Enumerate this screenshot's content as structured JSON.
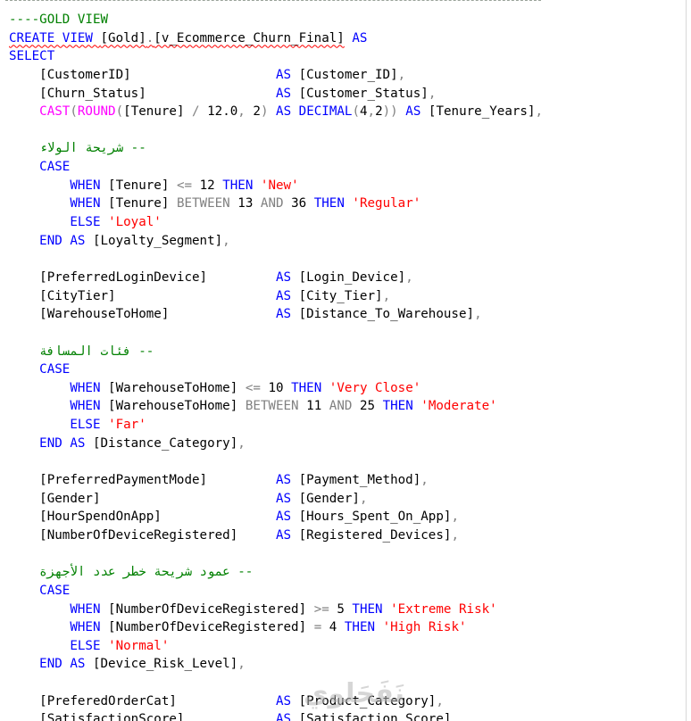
{
  "editor": {
    "lines": [
      [
        {
          "c": "cm",
          "t": "----GOLD VIEW"
        }
      ],
      [
        {
          "c": "kw",
          "t": "CREATE VIEW ",
          "sq": true
        },
        {
          "c": "tx",
          "t": "[Gold]",
          "sq": true
        },
        {
          "c": "op",
          "t": ".",
          "sq": true
        },
        {
          "c": "tx",
          "t": "[v_Ecommerce_Churn_Final]",
          "sq": true
        },
        {
          "c": "tx",
          "t": " "
        },
        {
          "c": "kw",
          "t": "AS"
        }
      ],
      [
        {
          "c": "kw",
          "t": "SELECT"
        }
      ],
      [
        {
          "c": "tx",
          "t": "    [CustomerID]                   "
        },
        {
          "c": "kw",
          "t": "AS"
        },
        {
          "c": "tx",
          "t": " [Customer_ID]"
        },
        {
          "c": "op",
          "t": ","
        }
      ],
      [
        {
          "c": "tx",
          "t": "    [Churn_Status]                 "
        },
        {
          "c": "kw",
          "t": "AS"
        },
        {
          "c": "tx",
          "t": " [Customer_Status]"
        },
        {
          "c": "op",
          "t": ","
        }
      ],
      [
        {
          "c": "tx",
          "t": "    "
        },
        {
          "c": "fn",
          "t": "CAST"
        },
        {
          "c": "op",
          "t": "("
        },
        {
          "c": "fn",
          "t": "ROUND"
        },
        {
          "c": "op",
          "t": "("
        },
        {
          "c": "tx",
          "t": "[Tenure] "
        },
        {
          "c": "op",
          "t": "/"
        },
        {
          "c": "tx",
          "t": " 12.0"
        },
        {
          "c": "op",
          "t": ","
        },
        {
          "c": "tx",
          "t": " 2"
        },
        {
          "c": "op",
          "t": ")"
        },
        {
          "c": "tx",
          "t": " "
        },
        {
          "c": "kw",
          "t": "AS DECIMAL"
        },
        {
          "c": "op",
          "t": "("
        },
        {
          "c": "tx",
          "t": "4"
        },
        {
          "c": "op",
          "t": ","
        },
        {
          "c": "tx",
          "t": "2"
        },
        {
          "c": "op",
          "t": "))"
        },
        {
          "c": "tx",
          "t": " "
        },
        {
          "c": "kw",
          "t": "AS"
        },
        {
          "c": "tx",
          "t": " [Tenure_Years]"
        },
        {
          "c": "op",
          "t": ","
        }
      ],
      [
        {
          "c": "tx",
          "t": ""
        }
      ],
      [
        {
          "c": "tx",
          "t": "    "
        },
        {
          "c": "cm",
          "t": "-- شريحة الولاء"
        }
      ],
      [
        {
          "c": "tx",
          "t": "    "
        },
        {
          "c": "kw",
          "t": "CASE"
        }
      ],
      [
        {
          "c": "tx",
          "t": "        "
        },
        {
          "c": "kw",
          "t": "WHEN"
        },
        {
          "c": "tx",
          "t": " [Tenure] "
        },
        {
          "c": "op",
          "t": "<="
        },
        {
          "c": "tx",
          "t": " 12 "
        },
        {
          "c": "kw",
          "t": "THEN"
        },
        {
          "c": "tx",
          "t": " "
        },
        {
          "c": "str",
          "t": "'New'"
        }
      ],
      [
        {
          "c": "tx",
          "t": "        "
        },
        {
          "c": "kw",
          "t": "WHEN"
        },
        {
          "c": "tx",
          "t": " [Tenure] "
        },
        {
          "c": "op",
          "t": "BETWEEN"
        },
        {
          "c": "tx",
          "t": " 13 "
        },
        {
          "c": "op",
          "t": "AND"
        },
        {
          "c": "tx",
          "t": " 36 "
        },
        {
          "c": "kw",
          "t": "THEN"
        },
        {
          "c": "tx",
          "t": " "
        },
        {
          "c": "str",
          "t": "'Regular'"
        }
      ],
      [
        {
          "c": "tx",
          "t": "        "
        },
        {
          "c": "kw",
          "t": "ELSE"
        },
        {
          "c": "tx",
          "t": " "
        },
        {
          "c": "str",
          "t": "'Loyal'"
        }
      ],
      [
        {
          "c": "tx",
          "t": "    "
        },
        {
          "c": "kw",
          "t": "END AS"
        },
        {
          "c": "tx",
          "t": " [Loyalty_Segment]"
        },
        {
          "c": "op",
          "t": ","
        }
      ],
      [
        {
          "c": "tx",
          "t": ""
        }
      ],
      [
        {
          "c": "tx",
          "t": "    [PreferredLoginDevice]         "
        },
        {
          "c": "kw",
          "t": "AS"
        },
        {
          "c": "tx",
          "t": " [Login_Device]"
        },
        {
          "c": "op",
          "t": ","
        }
      ],
      [
        {
          "c": "tx",
          "t": "    [CityTier]                     "
        },
        {
          "c": "kw",
          "t": "AS"
        },
        {
          "c": "tx",
          "t": " [City_Tier]"
        },
        {
          "c": "op",
          "t": ","
        }
      ],
      [
        {
          "c": "tx",
          "t": "    [WarehouseToHome]              "
        },
        {
          "c": "kw",
          "t": "AS"
        },
        {
          "c": "tx",
          "t": " [Distance_To_Warehouse]"
        },
        {
          "c": "op",
          "t": ","
        }
      ],
      [
        {
          "c": "tx",
          "t": ""
        }
      ],
      [
        {
          "c": "tx",
          "t": "    "
        },
        {
          "c": "cm",
          "t": "-- فئات المسافة"
        }
      ],
      [
        {
          "c": "tx",
          "t": "    "
        },
        {
          "c": "kw",
          "t": "CASE"
        }
      ],
      [
        {
          "c": "tx",
          "t": "        "
        },
        {
          "c": "kw",
          "t": "WHEN"
        },
        {
          "c": "tx",
          "t": " [WarehouseToHome] "
        },
        {
          "c": "op",
          "t": "<="
        },
        {
          "c": "tx",
          "t": " 10 "
        },
        {
          "c": "kw",
          "t": "THEN"
        },
        {
          "c": "tx",
          "t": " "
        },
        {
          "c": "str",
          "t": "'Very Close'"
        }
      ],
      [
        {
          "c": "tx",
          "t": "        "
        },
        {
          "c": "kw",
          "t": "WHEN"
        },
        {
          "c": "tx",
          "t": " [WarehouseToHome] "
        },
        {
          "c": "op",
          "t": "BETWEEN"
        },
        {
          "c": "tx",
          "t": " 11 "
        },
        {
          "c": "op",
          "t": "AND"
        },
        {
          "c": "tx",
          "t": " 25 "
        },
        {
          "c": "kw",
          "t": "THEN"
        },
        {
          "c": "tx",
          "t": " "
        },
        {
          "c": "str",
          "t": "'Moderate'"
        }
      ],
      [
        {
          "c": "tx",
          "t": "        "
        },
        {
          "c": "kw",
          "t": "ELSE"
        },
        {
          "c": "tx",
          "t": " "
        },
        {
          "c": "str",
          "t": "'Far'"
        }
      ],
      [
        {
          "c": "tx",
          "t": "    "
        },
        {
          "c": "kw",
          "t": "END AS"
        },
        {
          "c": "tx",
          "t": " [Distance_Category]"
        },
        {
          "c": "op",
          "t": ","
        }
      ],
      [
        {
          "c": "tx",
          "t": ""
        }
      ],
      [
        {
          "c": "tx",
          "t": "    [PreferredPaymentMode]         "
        },
        {
          "c": "kw",
          "t": "AS"
        },
        {
          "c": "tx",
          "t": " [Payment_Method]"
        },
        {
          "c": "op",
          "t": ","
        }
      ],
      [
        {
          "c": "tx",
          "t": "    [Gender]                       "
        },
        {
          "c": "kw",
          "t": "AS"
        },
        {
          "c": "tx",
          "t": " [Gender]"
        },
        {
          "c": "op",
          "t": ","
        }
      ],
      [
        {
          "c": "tx",
          "t": "    [HourSpendOnApp]               "
        },
        {
          "c": "kw",
          "t": "AS"
        },
        {
          "c": "tx",
          "t": " [Hours_Spent_On_App]"
        },
        {
          "c": "op",
          "t": ","
        }
      ],
      [
        {
          "c": "tx",
          "t": "    [NumberOfDeviceRegistered]     "
        },
        {
          "c": "kw",
          "t": "AS"
        },
        {
          "c": "tx",
          "t": " [Registered_Devices]"
        },
        {
          "c": "op",
          "t": ","
        }
      ],
      [
        {
          "c": "tx",
          "t": ""
        }
      ],
      [
        {
          "c": "tx",
          "t": "    "
        },
        {
          "c": "cm",
          "t": "-- عمود شريحة خطر عدد الأجهزة"
        }
      ],
      [
        {
          "c": "tx",
          "t": "    "
        },
        {
          "c": "kw",
          "t": "CASE"
        }
      ],
      [
        {
          "c": "tx",
          "t": "        "
        },
        {
          "c": "kw",
          "t": "WHEN"
        },
        {
          "c": "tx",
          "t": " [NumberOfDeviceRegistered] "
        },
        {
          "c": "op",
          "t": ">="
        },
        {
          "c": "tx",
          "t": " 5 "
        },
        {
          "c": "kw",
          "t": "THEN"
        },
        {
          "c": "tx",
          "t": " "
        },
        {
          "c": "str",
          "t": "'Extreme Risk'"
        }
      ],
      [
        {
          "c": "tx",
          "t": "        "
        },
        {
          "c": "kw",
          "t": "WHEN"
        },
        {
          "c": "tx",
          "t": " [NumberOfDeviceRegistered] "
        },
        {
          "c": "op",
          "t": "="
        },
        {
          "c": "tx",
          "t": " 4 "
        },
        {
          "c": "kw",
          "t": "THEN"
        },
        {
          "c": "tx",
          "t": " "
        },
        {
          "c": "str",
          "t": "'High Risk'"
        }
      ],
      [
        {
          "c": "tx",
          "t": "        "
        },
        {
          "c": "kw",
          "t": "ELSE"
        },
        {
          "c": "tx",
          "t": " "
        },
        {
          "c": "str",
          "t": "'Normal'"
        }
      ],
      [
        {
          "c": "tx",
          "t": "    "
        },
        {
          "c": "kw",
          "t": "END AS"
        },
        {
          "c": "tx",
          "t": " [Device_Risk_Level]"
        },
        {
          "c": "op",
          "t": ","
        }
      ],
      [
        {
          "c": "tx",
          "t": ""
        }
      ],
      [
        {
          "c": "tx",
          "t": "    [PreferedOrderCat]             "
        },
        {
          "c": "kw",
          "t": "AS"
        },
        {
          "c": "tx",
          "t": " [Product_Category]"
        },
        {
          "c": "op",
          "t": ","
        }
      ],
      [
        {
          "c": "tx",
          "t": "    [SatisfactionScore]            "
        },
        {
          "c": "kw",
          "t": "AS"
        },
        {
          "c": "tx",
          "t": " [Satisfaction_Score]"
        }
      ]
    ]
  },
  "watermark": {
    "text": "نَفَحَلوي"
  },
  "colors": {
    "keyword": "#0000ff",
    "function": "#ff00ff",
    "string": "#ff0000",
    "comment": "#008000",
    "operator": "#808080",
    "text": "#000000"
  }
}
